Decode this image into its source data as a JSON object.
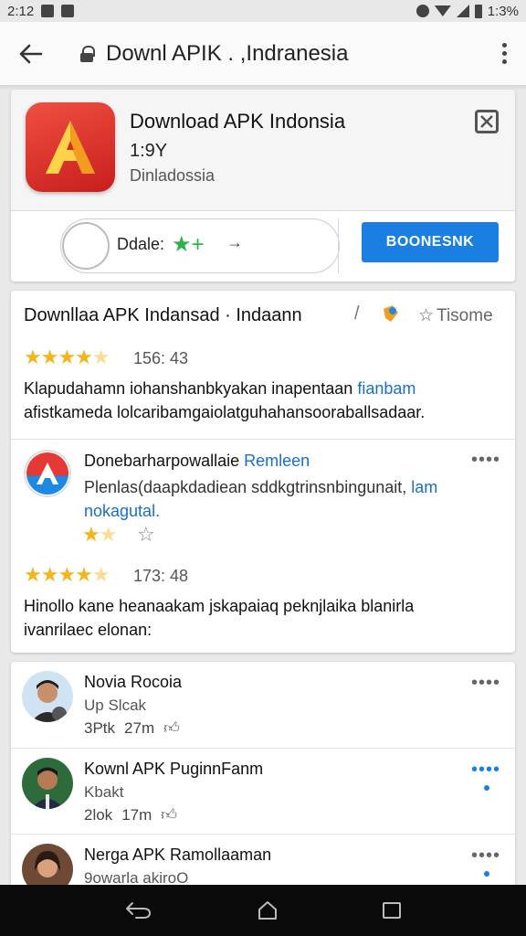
{
  "status_bar": {
    "time": "2:12",
    "battery": "1:3%"
  },
  "url_bar": {
    "url_text": "Downl APIK . ,Indranesia"
  },
  "app": {
    "title": "Download APK Indonsia",
    "version": "1:9Y",
    "developer": "Dinladossia",
    "pill_label": "Ddale:",
    "pill_star": "★+",
    "pill_arrow": "→",
    "button_label": "BOONESNK"
  },
  "review_section": {
    "title": "Downllaa APK Indansad · Indaann",
    "edit_glyph": "/",
    "tisome_label": "Tisome",
    "review1": {
      "rating_text": "156: 43",
      "stars": 4,
      "text_line1": "Klapudahamn iohanshanbkyakan inapentaan",
      "text_link": "fianbam",
      "text_line2": "afistkameda lolcaribamgaiolatguhahansooraballsadaar."
    },
    "review2": {
      "name": "Donebarharpowallaie",
      "name_link": "Remleen",
      "text_part1": "Plenlas(daapkdadiean sddkgtrinsnbingunait,",
      "text_link": "lam nokagutal.",
      "stars": 2,
      "more": "••••"
    },
    "review3": {
      "rating_text": "173: 48",
      "stars": 4,
      "text_line1": "Hinollo kane heanaakam jskapaiaq peknjlaika blanirla",
      "text_line2": "ivanrilaec elonan:"
    }
  },
  "users": [
    {
      "name": "Novia Rocoia",
      "sub": "Up Slcak",
      "meta_left": "3Ptk",
      "meta_time": "27m",
      "more": "••••"
    },
    {
      "name": "Kownl APK PuginnFanm",
      "sub": "Kbakt",
      "meta_left": "2lok",
      "meta_time": "17m",
      "more": "••••"
    },
    {
      "name": "Nerga APK Ramollaaman",
      "sub": "9owarla akiroO",
      "meta_left": "",
      "meta_time": "",
      "more": "••••"
    }
  ],
  "colors": {
    "accent": "#1a7fe0",
    "star": "#f2b51b",
    "app_icon": "#d92a22"
  },
  "icons": [
    "back-arrow-icon",
    "lock-icon",
    "more-vert-icon",
    "close-box-icon",
    "star-icon",
    "thumbs-up-icon",
    "nav-back-icon",
    "nav-home-icon",
    "nav-recents-icon"
  ]
}
